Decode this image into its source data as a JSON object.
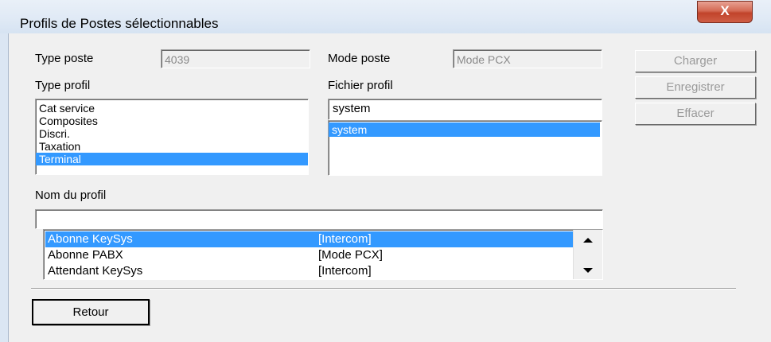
{
  "window": {
    "title": "Profils de Postes sélectionnables",
    "close_label": "X"
  },
  "type_poste": {
    "label": "Type poste",
    "value": "4039"
  },
  "mode_poste": {
    "label": "Mode poste",
    "value": "Mode PCX"
  },
  "type_profil": {
    "label": "Type profil",
    "items": [
      "Cat service",
      "Composites",
      "Discri.",
      "Taxation",
      "Terminal"
    ],
    "selected": "Terminal"
  },
  "fichier_profil": {
    "label": "Fichier profil",
    "value": "system",
    "items": [
      "system"
    ],
    "selected": "system"
  },
  "buttons": {
    "charger": "Charger",
    "enregistrer": "Enregistrer",
    "effacer": "Effacer",
    "retour": "Retour"
  },
  "nom_profil": {
    "label": "Nom du profil",
    "value": "",
    "rows": [
      {
        "name": "Abonne KeySys",
        "mode": "[Intercom]",
        "selected": true
      },
      {
        "name": "Abonne PABX",
        "mode": "[Mode PCX]",
        "selected": false
      },
      {
        "name": "Attendant KeySys",
        "mode": "[Intercom]",
        "selected": false
      }
    ]
  },
  "icons": {
    "close": "close-icon",
    "scroll_up": "scroll-up-arrow-icon",
    "scroll_down": "scroll-down-arrow-icon"
  },
  "colors": {
    "selection": "#3399ff",
    "dialog_bg": "#f0f0f0",
    "close_button": "#c1442b"
  }
}
